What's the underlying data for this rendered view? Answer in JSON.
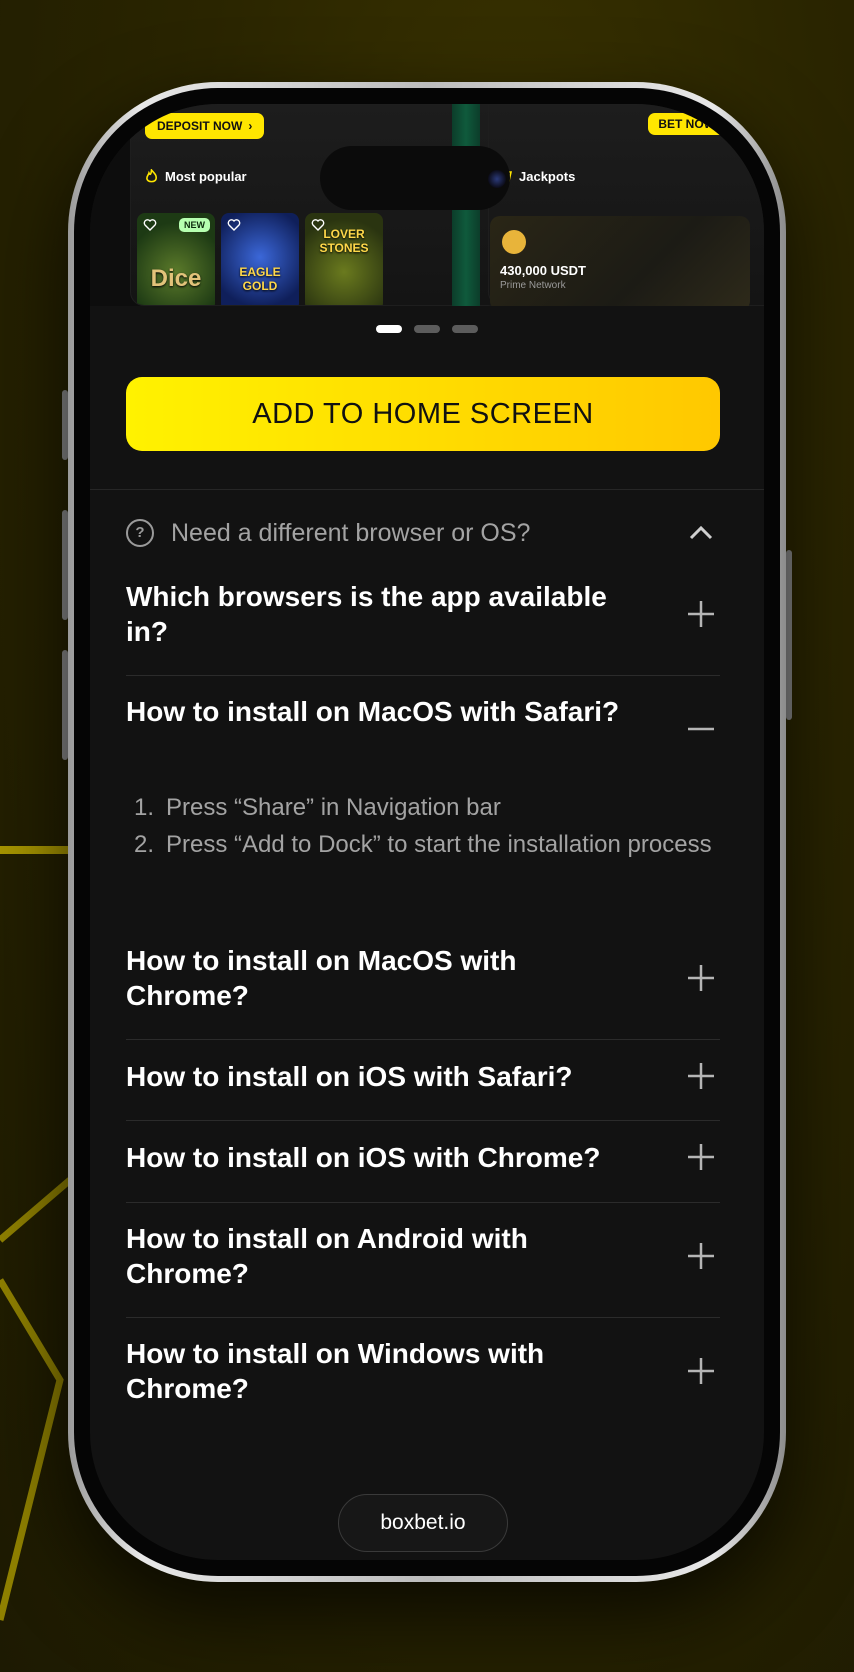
{
  "banner": {
    "deposit_label": "DEPOSIT NOW",
    "bet_label": "BET NOW",
    "most_popular_label": "Most popular",
    "jackpots_label": "Jackpots",
    "games": [
      {
        "title": "Dice",
        "badge": "NEW"
      },
      {
        "title": "EAGLE GOLD",
        "badge": ""
      },
      {
        "title": "LOVER STONES",
        "badge": ""
      }
    ],
    "jackpot_amount": "430,000 USDT",
    "jackpot_network": "Prime Network",
    "carousel_active_index": 0,
    "carousel_count": 3
  },
  "cta_label": "ADD TO HOME SCREEN",
  "other_browser": {
    "icon_char": "?",
    "label": "Need a different browser or OS?"
  },
  "faq": [
    {
      "question": "Which browsers is the app available in?",
      "expanded": false
    },
    {
      "question": "How to install on MacOS with Safari?",
      "expanded": true,
      "steps": [
        "Press “Share” in Navigation bar",
        "Press “Add to Dock” to start the installation process"
      ]
    },
    {
      "question": "How to install on MacOS with Chrome?",
      "expanded": false
    },
    {
      "question": "How to install on iOS with Safari?",
      "expanded": false
    },
    {
      "question": "How to install on iOS with Chrome?",
      "expanded": false
    },
    {
      "question": "How to install on Android with Chrome?",
      "expanded": false
    },
    {
      "question": "How to install on Windows with Chrome?",
      "expanded": false
    }
  ],
  "step_numbers": [
    "1.",
    "2."
  ],
  "site_url": "boxbet.io",
  "colors": {
    "accent": "#ffe600",
    "background": "#121212"
  }
}
